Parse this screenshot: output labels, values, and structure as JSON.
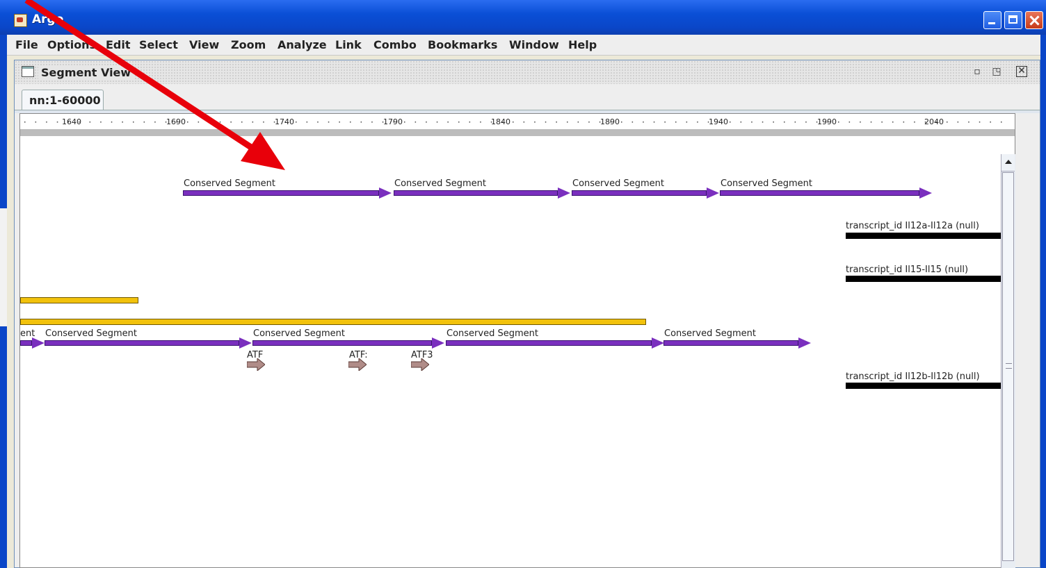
{
  "window": {
    "title": "Argo"
  },
  "menu": [
    {
      "label": "File"
    },
    {
      "label": "Options"
    },
    {
      "label": "Edit"
    },
    {
      "label": "Select"
    },
    {
      "label": "View"
    },
    {
      "label": "Zoom"
    },
    {
      "label": "Analyze"
    },
    {
      "label": "Link"
    },
    {
      "label": "Combo"
    },
    {
      "label": "Bookmarks"
    },
    {
      "label": "Window"
    },
    {
      "label": "Help"
    }
  ],
  "panel": {
    "title": "Segment View",
    "tab": "nn:1-60000",
    "ruler_ticks": [
      "1640",
      "1690",
      "1740",
      "1790",
      "1840",
      "1890",
      "1940",
      "1990",
      "2040"
    ]
  },
  "features": {
    "row1": [
      "Conserved Segment",
      "Conserved Segment",
      "Conserved Segment",
      "Conserved Segment"
    ],
    "transcripts": [
      "transcript_id Il12a-Il12a (null)",
      "transcript_id Il15-Il15 (null)",
      "transcript_id Il12b-Il12b (null)"
    ],
    "row2_fragment": "ent",
    "row2": [
      "Conserved Segment",
      "Conserved Segment",
      "Conserved Segment",
      "Conserved Segment"
    ],
    "atf": [
      "ATF",
      "ATF:",
      "ATF3"
    ]
  },
  "colors": {
    "segment": "#7a2fbe",
    "yellow": "#f2c20c",
    "transcript": "#000000",
    "atf": "#b08c88",
    "annotation_arrow": "#e8000a"
  }
}
